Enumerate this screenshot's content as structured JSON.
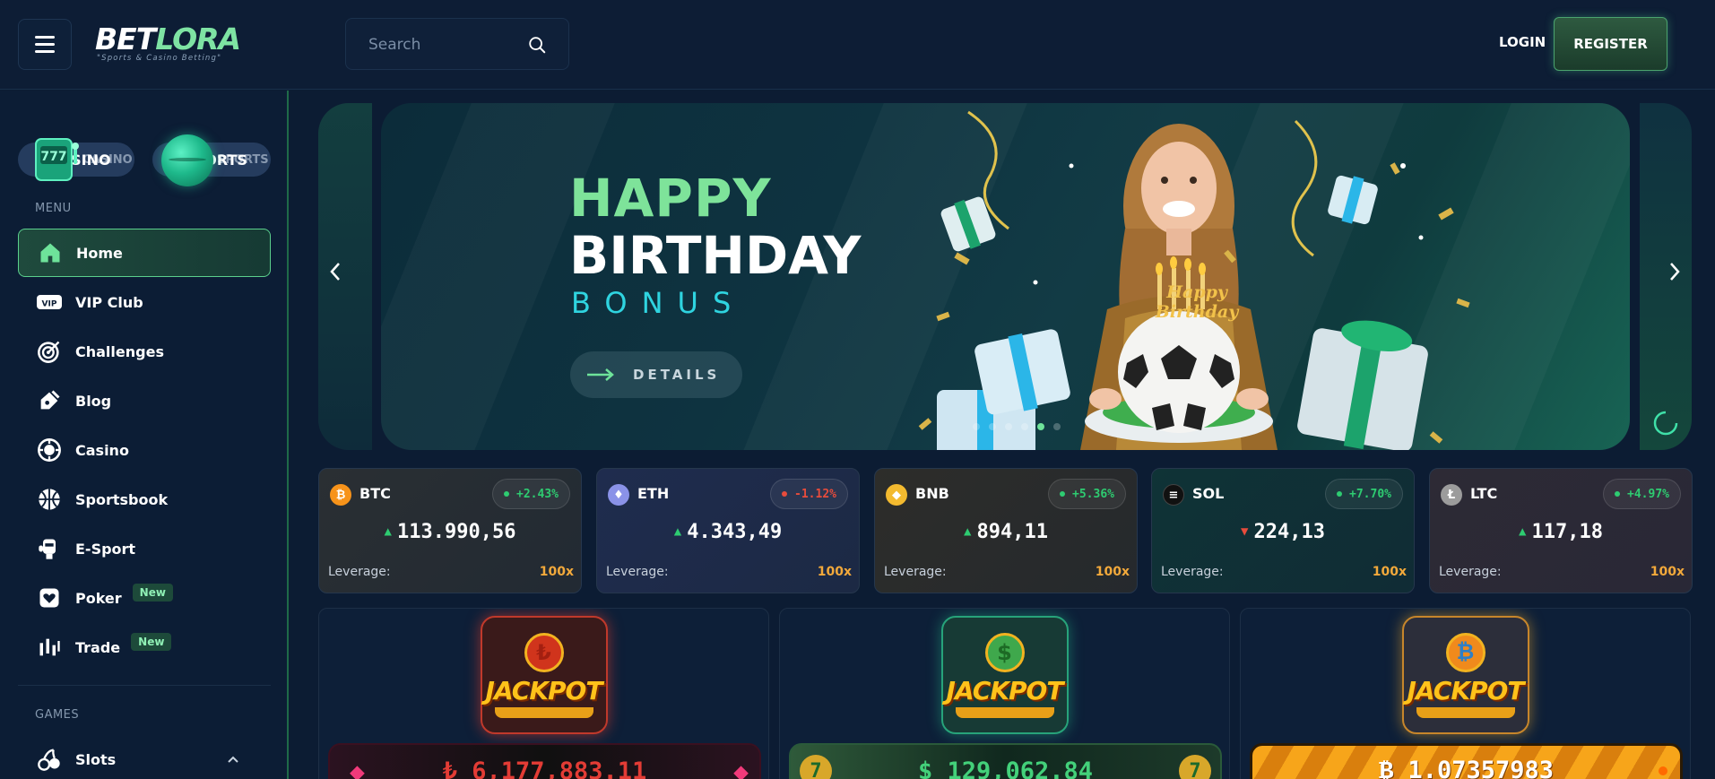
{
  "header": {
    "logo_main_a": "BET",
    "logo_main_b": "LORA",
    "logo_tagline": "\"Sports & Casino Betting\"",
    "search_placeholder": "Search",
    "login_label": "LOGIN",
    "register_label": "REGISTER"
  },
  "sidebar": {
    "casino_label": "CASINO",
    "casino_ghost": "CASINO",
    "sports_label": "SPORTS",
    "sports_ghost": "SPORTS",
    "menu_heading": "MENU",
    "items": [
      {
        "label": "Home",
        "icon": "home-icon",
        "active": true
      },
      {
        "label": "VIP Club",
        "icon": "vip-icon"
      },
      {
        "label": "Challenges",
        "icon": "target-icon"
      },
      {
        "label": "Blog",
        "icon": "blog-icon"
      },
      {
        "label": "Casino",
        "icon": "chip-icon"
      },
      {
        "label": "Sportsbook",
        "icon": "basketball-icon"
      },
      {
        "label": "E-Sport",
        "icon": "esport-icon"
      },
      {
        "label": "Poker",
        "icon": "poker-icon",
        "badge": "New"
      },
      {
        "label": "Trade",
        "icon": "trade-icon",
        "badge": "New"
      }
    ],
    "games_heading": "GAMES",
    "games_items": [
      {
        "label": "Slots",
        "icon": "cherries-icon"
      }
    ]
  },
  "banner": {
    "line1": "HAPPY",
    "line2": "BIRTHDAY",
    "line3": "BONUS",
    "cta": "DETAILS",
    "cake_text": "Happy Birthday",
    "dots_total": 6,
    "active_dot": 4
  },
  "tickers": [
    {
      "symbol": "BTC",
      "change": "+2.43%",
      "direction": "up",
      "price": "113.990,56",
      "leverage_label": "Leverage:",
      "leverage": "100x",
      "coin_color": "#f7931a",
      "coin_glyph": "₿"
    },
    {
      "symbol": "ETH",
      "change": "-1.12%",
      "direction": "up",
      "price": "4.343,49",
      "leverage_label": "Leverage:",
      "leverage": "100x",
      "coin_color": "#8a92e8",
      "coin_glyph": "♦"
    },
    {
      "symbol": "BNB",
      "change": "+5.36%",
      "direction": "up",
      "price": "894,11",
      "leverage_label": "Leverage:",
      "leverage": "100x",
      "coin_color": "#f3ba2f",
      "coin_glyph": "◆"
    },
    {
      "symbol": "SOL",
      "change": "+7.70%",
      "direction": "down",
      "price": "224,13",
      "leverage_label": "Leverage:",
      "leverage": "100x",
      "coin_color": "#111111",
      "coin_glyph": "≡"
    },
    {
      "symbol": "LTC",
      "change": "+4.97%",
      "direction": "up",
      "price": "117,18",
      "leverage_label": "Leverage:",
      "leverage": "100x",
      "coin_color": "#9c9c9c",
      "coin_glyph": "Ł"
    }
  ],
  "jackpots": [
    {
      "word": "JACKPOT",
      "coin": "₺",
      "amount": "₺ 6,177,883.11",
      "theme": "red"
    },
    {
      "word": "JACKPOT",
      "coin": "$",
      "amount": "$ 129,062.84",
      "theme": "green"
    },
    {
      "word": "JACKPOT",
      "coin": "₿",
      "amount": "₿ 1.07357983",
      "theme": "gold"
    }
  ],
  "colors": {
    "accent": "#7ee3a3",
    "up": "#2ecc71",
    "down": "#e74c3c",
    "leverage": "#f2a93b"
  }
}
